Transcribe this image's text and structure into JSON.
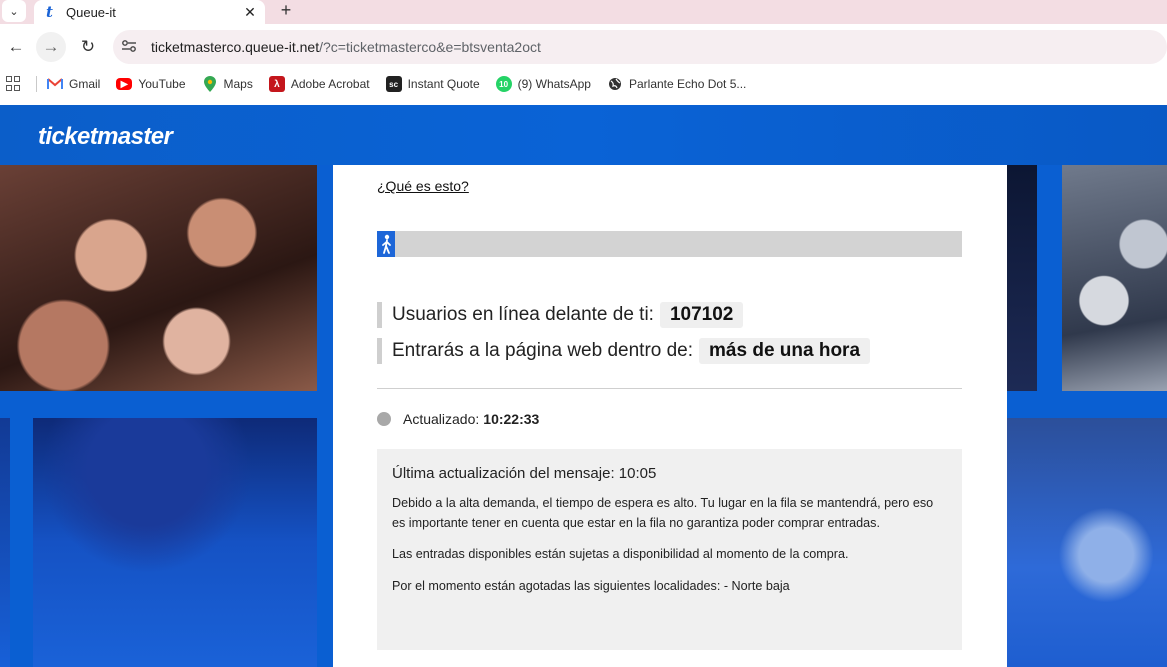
{
  "browser": {
    "tab_title": "Queue-it",
    "tab_favicon": "t",
    "url_host": "ticketmasterco.queue-it.net",
    "url_rest": "/?c=ticketmasterco&e=btsventa2oct",
    "bookmarks": [
      {
        "label": "Gmail",
        "icon": "gmail-icon",
        "color": "#ea4335"
      },
      {
        "label": "YouTube",
        "icon": "youtube-icon",
        "color": "#ff0000"
      },
      {
        "label": "Maps",
        "icon": "maps-icon",
        "color": "#34a853"
      },
      {
        "label": "Adobe Acrobat",
        "icon": "acrobat-icon",
        "color": "#c4161c"
      },
      {
        "label": "Instant Quote",
        "icon": "instant-quote-icon",
        "color": "#222222"
      },
      {
        "label": "(9) WhatsApp",
        "icon": "whatsapp-icon",
        "color": "#25d366"
      },
      {
        "label": "Parlante Echo Dot 5...",
        "icon": "globe-icon",
        "color": "#333333"
      }
    ],
    "whatsapp_badge": "10",
    "instant_quote_badge": "sc"
  },
  "page": {
    "logo": "ticketmaster",
    "what_link": "¿Qué es esto?",
    "progress_fraction": 0.03,
    "users_ahead_label": "Usuarios en línea delante de ti:",
    "users_ahead_value": "107102",
    "eta_label": "Entrarás a la página web dentro de:",
    "eta_value": "más de una hora",
    "updated_label": "Actualizado:",
    "updated_time": "10:22:33",
    "message_title": "Última actualización del mensaje: 10:05",
    "message_p1": "Debido a la alta demanda, el tiempo de espera es alto. Tu lugar en la fila se mantendrá, pero eso es importante tener en cuenta que estar en la fila no garantiza poder comprar entradas.",
    "message_p2": "Las entradas disponibles están sujetas a disponibilidad al momento de la compra.",
    "message_p3": "Por el momento están agotadas las siguientes localidades: - Norte baja"
  },
  "colors": {
    "brand_blue": "#0a63d6",
    "progress_fill": "#1d66d8"
  }
}
